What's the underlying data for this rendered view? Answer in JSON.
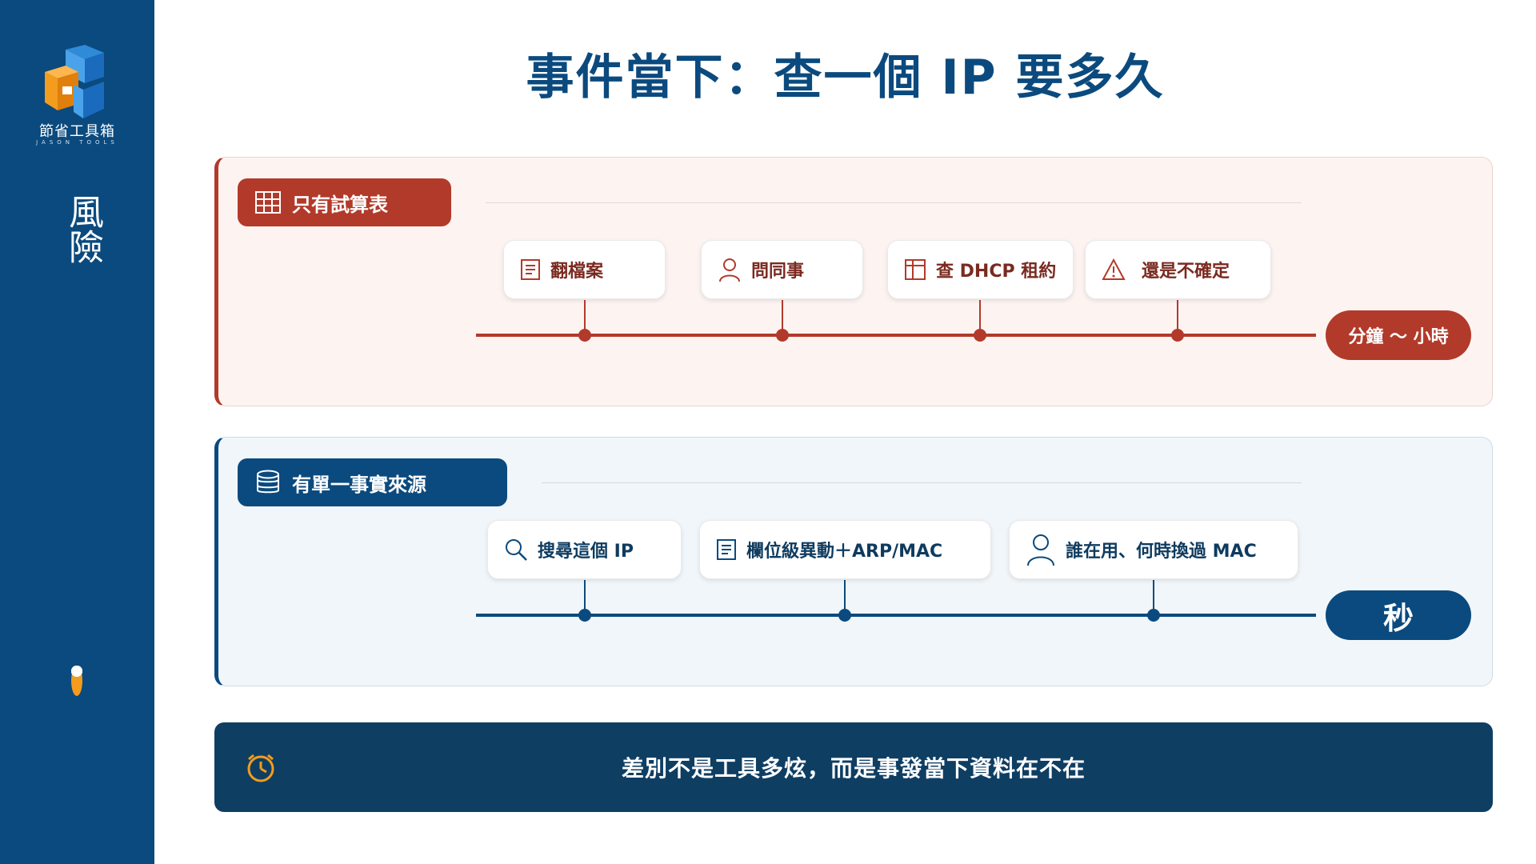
{
  "sidebar": {
    "brand_name": "節省工具箱",
    "brand_sub": "JASON TOOLS",
    "section_label": "風險",
    "pager": {
      "total": 5,
      "active_index": 1
    }
  },
  "title": "事件當下：查一個 IP 要多久",
  "panels": {
    "spreadsheet": {
      "tag": "只有試算表",
      "steps": [
        "翻檔案",
        "問同事",
        "查 DHCP 租約",
        "還是不確定"
      ],
      "duration": "分鐘 ～ 小時"
    },
    "single_source": {
      "tag": "有單一事實來源",
      "steps": [
        "搜尋這個 IP",
        "欄位級異動＋ARP/MAC",
        "誰在用、何時換過 MAC"
      ],
      "duration": "秒"
    }
  },
  "banner": {
    "text": "差別不是工具多炫，而是事發當下資料在不在"
  },
  "colors": {
    "brand_blue": "#0b4a7e",
    "danger_red": "#b23a2a",
    "banner_navy": "#0f3e63",
    "accent_orange": "#f39c1e"
  },
  "icons": {
    "logo": "cube-logo",
    "spreadsheet_tag": "grid-icon",
    "single_source_tag": "database-icon",
    "banner": "clock-alert-icon"
  }
}
